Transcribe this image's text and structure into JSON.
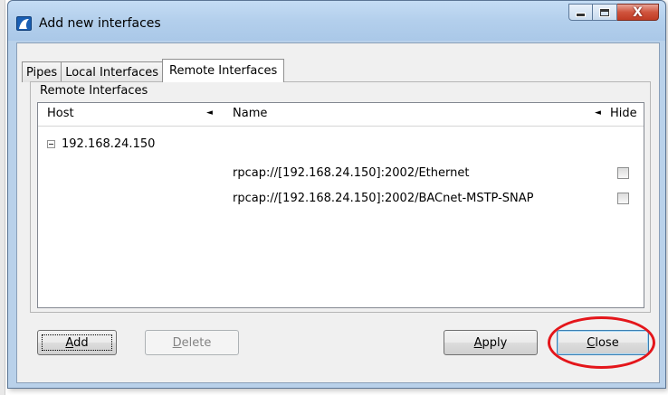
{
  "window": {
    "title": "Add new interfaces",
    "caption_buttons": [
      "minimize-icon",
      "maximize-icon",
      "close-icon"
    ],
    "close_glyph": "X"
  },
  "tabs": [
    {
      "label": "Pipes",
      "active": false
    },
    {
      "label": "Local Interfaces",
      "active": false
    },
    {
      "label": "Remote Interfaces",
      "active": true
    }
  ],
  "group": {
    "title": "Remote Interfaces"
  },
  "list": {
    "columns": {
      "host": "Host",
      "name": "Name",
      "hide": "Hide"
    },
    "sort_glyph": "◄",
    "hosts": [
      {
        "host": "192.168.24.150",
        "expanded": true,
        "interfaces": [
          {
            "name": "rpcap://[192.168.24.150]:2002/Ethernet",
            "hide": false
          },
          {
            "name": "rpcap://[192.168.24.150]:2002/BACnet-MSTP-SNAP",
            "hide": false
          }
        ]
      }
    ]
  },
  "buttons": {
    "add": "Add",
    "delete": "Delete",
    "apply": "Apply",
    "close": "Close"
  },
  "colors": {
    "highlight": "#e4161b",
    "frame": "#b9d1ea",
    "client": "#f0f0f0"
  }
}
